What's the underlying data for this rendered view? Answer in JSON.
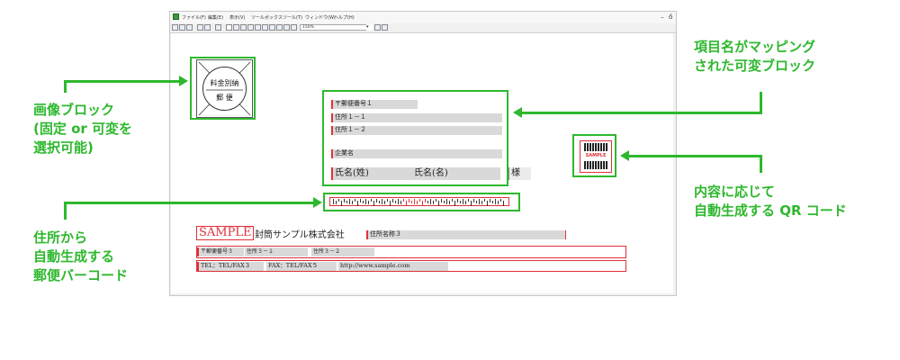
{
  "menu": {
    "items": [
      "ファイル(F)",
      "編集(E)",
      "表示(V)",
      "ツールボックス",
      "ツール(T)",
      "ウィンドウ(W)",
      "ヘルプ(H)"
    ],
    "minimize": "–",
    "restore": "ő"
  },
  "toolbar": {
    "zoom": "150%",
    "icons": [
      "new-icon",
      "open-icon",
      "save-icon",
      "print-icon",
      "preview-icon",
      "print-setup-icon",
      "pointer-icon",
      "rotate-icon",
      "image-icon",
      "text-icon",
      "table-icon",
      "rect-icon",
      "line-icon",
      "ellipse-icon",
      "barcode-icon",
      "qr-icon",
      "grid-icon",
      "copy-icon",
      "paste-icon"
    ]
  },
  "stamp": {
    "line1": "料金別納",
    "line2": "郵 便"
  },
  "address_block": {
    "postal": "〒郵便番号１",
    "addr1": "住所１－１",
    "addr2": "住所１－２",
    "company": "企業名",
    "lastname": "氏名(姓)",
    "firstname": "氏名(名)",
    "honorific": "様"
  },
  "qr": {
    "label": "SAMPLE"
  },
  "footer": {
    "sample": "SAMPLE",
    "company": "封筒サンプル株式会社",
    "addrname": "住所名称３",
    "postal": "〒郵便番号３",
    "addr31": "住所３－１",
    "addr32": "住所３－２",
    "tel": "TEL：TEL/FAX３",
    "fax": "FAX：TEL/FAX５",
    "url": "http://www.sample.com"
  },
  "callouts": {
    "image_block": [
      "画像ブロック",
      "(固定 or 可変を",
      "選択可能)"
    ],
    "mapped_block": [
      "項目名がマッピング",
      "された可変ブロック"
    ],
    "qr_code": [
      "内容に応じて",
      "自動生成する QR コード"
    ],
    "barcode": [
      "住所から",
      "自動生成する",
      "郵便バーコード"
    ]
  },
  "colors": {
    "accent_green": "#2eb82e",
    "field_red": "#e0303a",
    "field_bg": "#d9d9d9"
  }
}
